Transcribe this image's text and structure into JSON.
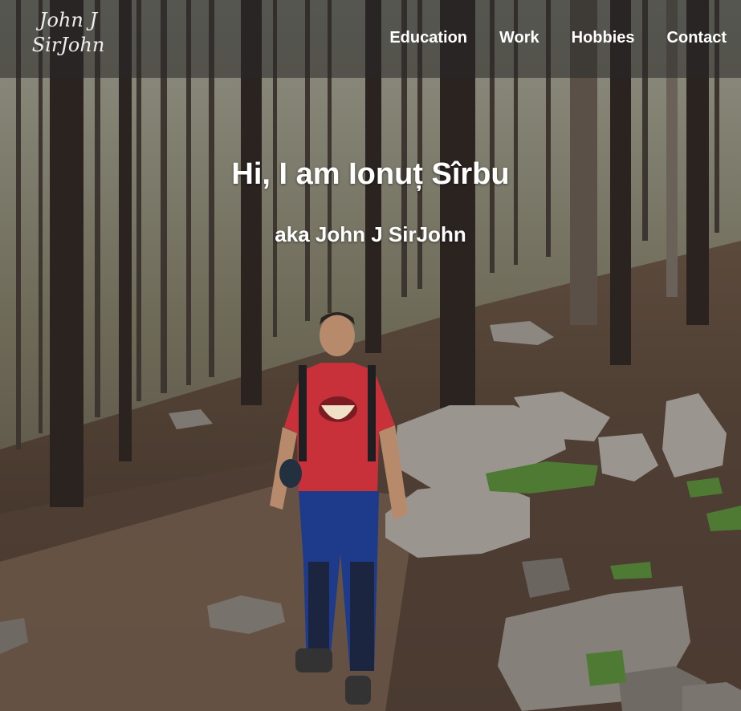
{
  "logo": {
    "line1": "John J",
    "line2": "SirJohn"
  },
  "nav": {
    "items": [
      {
        "label": "Education"
      },
      {
        "label": "Work"
      },
      {
        "label": "Hobbies"
      },
      {
        "label": "Contact"
      }
    ]
  },
  "hero": {
    "title": "Hi, I am Ionuț Sîrbu",
    "subtitle": "aka John J SirJohn"
  },
  "colors": {
    "overlay": "#282828",
    "text": "#ffffff",
    "shirt": "#c8303a",
    "pants": "#1e3a8a"
  }
}
